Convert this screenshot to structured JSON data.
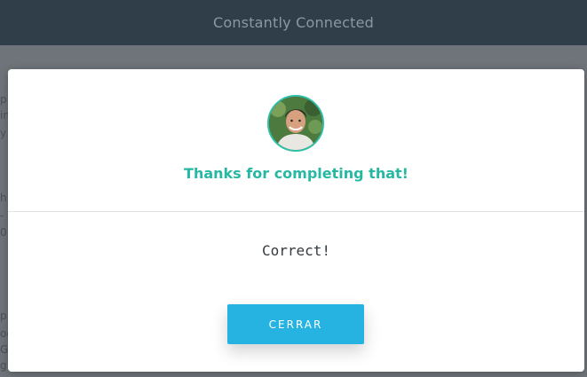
{
  "header": {
    "title": "Constantly Connected"
  },
  "background": {
    "fragments": [
      "p",
      "in",
      "y",
      "h",
      "-",
      "01",
      "p",
      "oc",
      "G",
      "g"
    ]
  },
  "modal": {
    "avatar_icon": "person-avatar",
    "title": "Thanks for completing that!",
    "message": "Correct!",
    "close_label": "CERRAR"
  },
  "colors": {
    "accent": "#27b8a3",
    "button": "#27b3e2",
    "header_bg": "#2f3e48"
  }
}
